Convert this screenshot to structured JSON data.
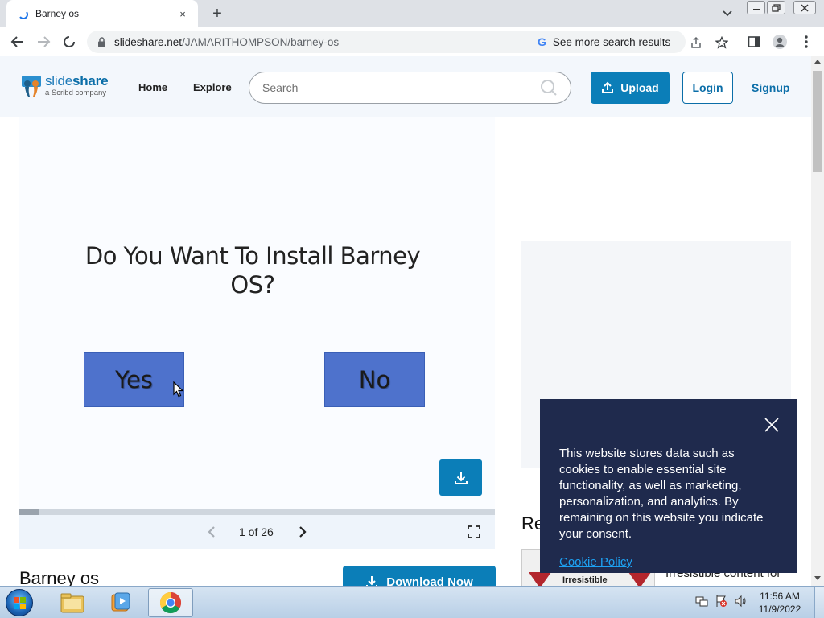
{
  "browser": {
    "tab": {
      "title": "Barney os",
      "close_label": "×"
    },
    "new_tab_label": "+",
    "url": {
      "host": "slideshare.net",
      "path": "/JAMARITHOMPSON/barney-os"
    },
    "search_chip": {
      "g_label": "G",
      "text": "See more search results"
    },
    "window_controls": {
      "minimize": "minimize",
      "restore": "restore",
      "close": "close"
    }
  },
  "site_header": {
    "logo": {
      "name_plain": "slide",
      "name_bold": "share",
      "subtitle": "a Scribd company"
    },
    "nav": [
      {
        "label": "Home"
      },
      {
        "label": "Explore"
      }
    ],
    "search": {
      "placeholder": "Search",
      "value": ""
    },
    "upload_label": "Upload",
    "login_label": "Login",
    "signup_label": "Signup"
  },
  "slide": {
    "title": "Do You Want To Install Barney OS?",
    "yes_label": "Yes",
    "no_label": "No",
    "colors": {
      "button": "#4e72cc"
    }
  },
  "viewer": {
    "progress": 0.04,
    "pager_text": "1 of 26"
  },
  "document": {
    "title": "Barney os",
    "download_label": "Download Now"
  },
  "related": {
    "heading": "Re",
    "thumb_text": "Irresistible",
    "item_text": "Irresistible content for"
  },
  "cookie_banner": {
    "text": "This website stores data such as cookies to enable essential site functionality, as well as marketing, personalization, and analytics. By remaining on this website you indicate your consent.",
    "link_label": "Cookie Policy"
  },
  "taskbar": {
    "apps": [
      {
        "name": "explorer-icon"
      },
      {
        "name": "media-player-icon"
      },
      {
        "name": "chrome-icon"
      }
    ],
    "clock": {
      "time": "11:56 AM",
      "date": "11/9/2022"
    }
  },
  "colors": {
    "brand_blue": "#0b7eb8",
    "header_bg": "#f3f7fc",
    "cookie_bg": "#1f2a4d",
    "cookie_link": "#1da1f2"
  }
}
